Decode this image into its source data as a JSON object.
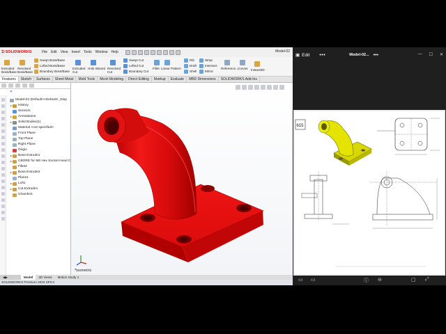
{
  "solidworks": {
    "brand": "SOLIDWORKS",
    "menu": [
      "File",
      "Edit",
      "View",
      "Insert",
      "Tools",
      "Window",
      "Help"
    ],
    "document_name": "Model-02",
    "ribbon": {
      "extruded_boss": "Extruded Boss/Base",
      "revolved_boss": "Revolved Boss/Base",
      "swept_boss": "Swept Boss/Base",
      "lofted_boss": "Lofted Boss/Base",
      "boundary_boss": "Boundary Boss/Base",
      "extruded_cut": "Extruded Cut",
      "hole_wizard": "Hole Wizard",
      "revolved_cut": "Revolved Cut",
      "swept_cut": "Swept Cut",
      "lofted_cut": "Lofted Cut",
      "boundary_cut": "Boundary Cut",
      "fillet": "Fillet",
      "linear_pattern": "Linear Pattern",
      "rib": "Rib",
      "draft": "Draft",
      "shell": "Shell",
      "wrap": "Wrap",
      "intersect": "Intersect",
      "mirror": "Mirror",
      "reference": "Reference...",
      "curves": "Curves",
      "instant3d": "Instant3D"
    },
    "tabs": [
      "Features",
      "Sketch",
      "Surfaces",
      "Sheet Metal",
      "Mold Tools",
      "Mesh Modeling",
      "Direct Editing",
      "Markup",
      "Evaluate",
      "MBD Dimensions",
      "SOLIDWORKS Add-Ins"
    ],
    "active_tab": "Features",
    "tree": [
      {
        "label": "Model-02  (Default<<Default>_Disp",
        "arrow": "",
        "color": "#9aa6b4"
      },
      {
        "label": "History",
        "arrow": "▸",
        "color": "#c89a3a"
      },
      {
        "label": "Sensors",
        "arrow": "",
        "color": "#5b8fd6"
      },
      {
        "label": "Annotations",
        "arrow": "▸",
        "color": "#d6a33a"
      },
      {
        "label": "Solid Bodies(1)",
        "arrow": "▸",
        "color": "#8a8a8a"
      },
      {
        "label": "Material <not specified>",
        "arrow": "",
        "color": "#7a9ac6"
      },
      {
        "label": "Front Plane",
        "arrow": "",
        "color": "#9bb0c8"
      },
      {
        "label": "Top Plane",
        "arrow": "",
        "color": "#9bb0c8"
      },
      {
        "label": "Right Plane",
        "arrow": "",
        "color": "#9bb0c8"
      },
      {
        "label": "Origin",
        "arrow": "",
        "color": "#c44"
      },
      {
        "label": "Boss-Extrude1",
        "arrow": "▸",
        "color": "#c8a050"
      },
      {
        "label": "CBORE for M6 Hex Socket Head C",
        "arrow": "▸",
        "color": "#c8a050"
      },
      {
        "label": "Fillet2",
        "arrow": "",
        "color": "#c8a050"
      },
      {
        "label": "Boss-Extrude2",
        "arrow": "▸",
        "color": "#c8a050"
      },
      {
        "label": "Plane1",
        "arrow": "",
        "color": "#9bb0c8"
      },
      {
        "label": "Loft1",
        "arrow": "▸",
        "color": "#c8a050"
      },
      {
        "label": "Cut-Extrude1",
        "arrow": "▸",
        "color": "#c8a050"
      },
      {
        "label": "Chamfer1",
        "arrow": "",
        "color": "#c8a050"
      }
    ],
    "view_label": "*Isometric",
    "bottom_tabs": [
      "Model",
      "3D Views",
      "Motion Study 1"
    ],
    "status": "SOLIDWORKS Premium 2020 SP0.0",
    "model_color": "#e81010"
  },
  "viewer": {
    "edit_label": "Edit",
    "title": "Model-02...",
    "drawing_number": "615"
  }
}
